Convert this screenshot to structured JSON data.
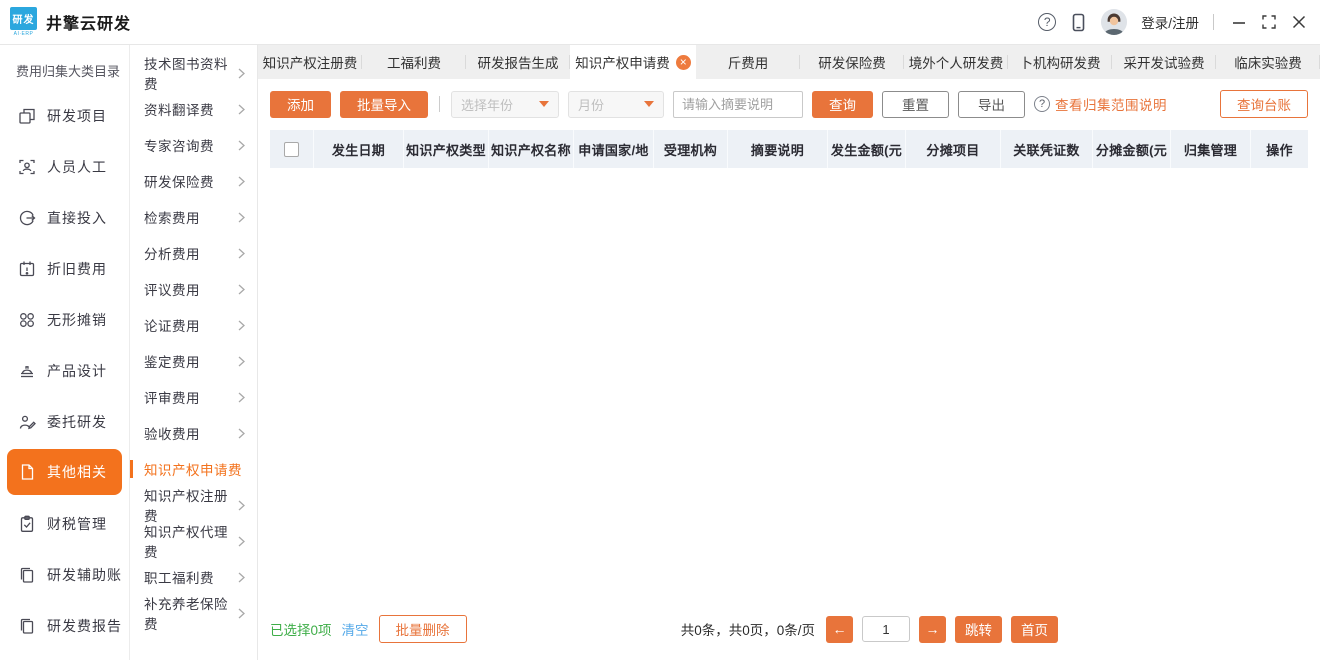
{
  "titlebar": {
    "logo_text": "研发",
    "logo_subtext": "AI·ERP",
    "app_title": "井擎云研发",
    "login_label": "登录/注册"
  },
  "sidebar": {
    "title": "费用归集大类目录",
    "items": [
      {
        "label": "研发项目"
      },
      {
        "label": "人员人工"
      },
      {
        "label": "直接投入"
      },
      {
        "label": "折旧费用"
      },
      {
        "label": "无形摊销"
      },
      {
        "label": "产品设计"
      },
      {
        "label": "委托研发"
      },
      {
        "label": "其他相关"
      },
      {
        "label": "财税管理"
      },
      {
        "label": "研发辅助账"
      },
      {
        "label": "研发费报告"
      }
    ]
  },
  "submenu": {
    "items": [
      {
        "label": "技术图书资料费"
      },
      {
        "label": "资料翻译费"
      },
      {
        "label": "专家咨询费"
      },
      {
        "label": "研发保险费"
      },
      {
        "label": "检索费用"
      },
      {
        "label": "分析费用"
      },
      {
        "label": "评议费用"
      },
      {
        "label": "论证费用"
      },
      {
        "label": "鉴定费用"
      },
      {
        "label": "评审费用"
      },
      {
        "label": "验收费用"
      },
      {
        "label": "知识产权申请费"
      },
      {
        "label": "知识产权注册费"
      },
      {
        "label": "知识产权代理费"
      },
      {
        "label": "职工福利费"
      },
      {
        "label": "补充养老保险费"
      }
    ]
  },
  "tabs": [
    {
      "label": "知识产权注册费"
    },
    {
      "label": "工福利费"
    },
    {
      "label": "研发报告生成"
    },
    {
      "label": "知识产权申请费"
    },
    {
      "label": "斤费用"
    },
    {
      "label": "研发保险费"
    },
    {
      "label": "境外个人研发费"
    },
    {
      "label": "卜机构研发费"
    },
    {
      "label": "采开发试验费"
    },
    {
      "label": "临床实验费"
    }
  ],
  "toolbar": {
    "add_label": "添加",
    "batch_import_label": "批量导入",
    "year_placeholder": "选择年份",
    "month_placeholder": "月份",
    "summary_placeholder": "请输入摘要说明",
    "query_label": "查询",
    "reset_label": "重置",
    "export_label": "导出",
    "scope_help_label": "查看归集范围说明",
    "ledger_label": "查询台账"
  },
  "table": {
    "columns": [
      "发生日期",
      "知识产权类型",
      "知识产权名称",
      "申请国家/地",
      "受理机构",
      "摘要说明",
      "发生金额(元",
      "分摊项目",
      "关联凭证数",
      "分摊金额(元",
      "归集管理",
      "操作"
    ],
    "rows": []
  },
  "footer": {
    "selected_text": "已选择0项",
    "clear_label": "清空",
    "batch_delete_label": "批量删除",
    "summary_text": "共0条，共0页，0条/页",
    "prev_label": "←",
    "next_label": "→",
    "page_value": "1",
    "jump_label": "跳转",
    "first_page_label": "首页"
  },
  "colors": {
    "accent": "#e8743b",
    "active_nav": "#f3721d",
    "selected_green": "#3fae49",
    "clear_blue": "#55a9e8",
    "logo_blue": "#2ba7de",
    "table_header_bg": "#edf1f6",
    "tabbar_bg": "#efefef"
  }
}
